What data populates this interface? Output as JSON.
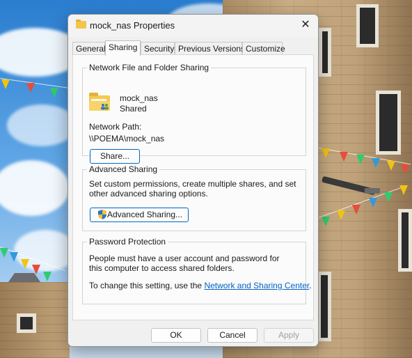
{
  "window": {
    "title": "mock_nas Properties",
    "close_glyph": "✕"
  },
  "tabs": [
    {
      "label": "General"
    },
    {
      "label": "Sharing",
      "active": true
    },
    {
      "label": "Security"
    },
    {
      "label": "Previous Versions"
    },
    {
      "label": "Customize"
    }
  ],
  "network_sharing": {
    "group_title": "Network File and Folder Sharing",
    "folder_name": "mock_nas",
    "folder_status": "Shared",
    "network_path_label": "Network Path:",
    "network_path": "\\\\POEMA\\mock_nas",
    "share_button": "Share..."
  },
  "advanced_sharing": {
    "group_title": "Advanced Sharing",
    "description": "Set custom permissions, create multiple shares, and set other advanced sharing options.",
    "button": "Advanced Sharing..."
  },
  "password_protection": {
    "group_title": "Password Protection",
    "description": "People must have a user account and password for this computer to access shared folders.",
    "change_prefix": "To change this setting, use the ",
    "link_text": "Network and Sharing Center",
    "change_suffix": "."
  },
  "footer": {
    "ok": "OK",
    "cancel": "Cancel",
    "apply": "Apply",
    "apply_enabled": false
  },
  "icons": {
    "title": "folder-icon",
    "folder": "shared-folder-icon",
    "uac": "uac-shield-icon"
  }
}
